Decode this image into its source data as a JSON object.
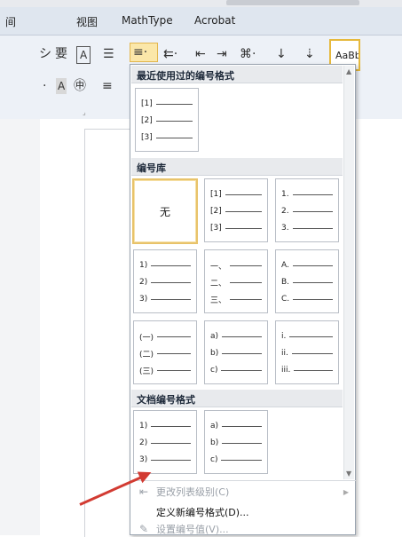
{
  "menubar": {
    "tabs": [
      "间",
      "视图",
      "MathType",
      "Acrobat"
    ]
  },
  "ribbon": {
    "style_preview": "AaBb",
    "row1_icons": [
      "シ",
      "要",
      "A",
      "☰",
      "≡·",
      "⇇·",
      "⇤",
      "⇥",
      "⌘·",
      "↓",
      "⇣"
    ],
    "row2_icons": [
      "·",
      "A",
      "㊥",
      "≡"
    ]
  },
  "dropdown": {
    "recent_header": "最近使用过的编号格式",
    "library_header": "编号库",
    "document_header": "文档编号格式",
    "none_label": "无",
    "recent": [
      [
        "[1]",
        "[2]",
        "[3]"
      ]
    ],
    "library": [
      [
        "[1]",
        "[2]",
        "[3]"
      ],
      [
        "1.",
        "2.",
        "3."
      ],
      [
        "1)",
        "2)",
        "3)"
      ],
      [
        "一、",
        "二、",
        "三、"
      ],
      [
        "A.",
        "B.",
        "C."
      ],
      [
        "(一)",
        "(二)",
        "(三)"
      ],
      [
        "a)",
        "b)",
        "c)"
      ],
      [
        "i.",
        "ii.",
        "iii."
      ]
    ],
    "document": [
      [
        "1)",
        "2)",
        "3)"
      ],
      [
        "a)",
        "b)",
        "c)"
      ]
    ],
    "menu": {
      "change_level": "更改列表级别(C)",
      "define_new": "定义新编号格式(D)...",
      "set_value": "设置编号值(V)..."
    }
  },
  "colors": {
    "selected_border": "#e8c36a",
    "annotation_arrow": "#d23b32",
    "highlight_button": "#fbe7a9"
  }
}
